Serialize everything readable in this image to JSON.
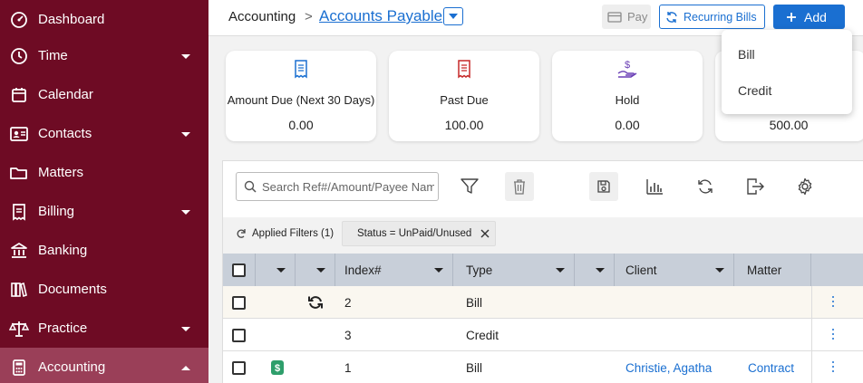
{
  "sidebar": {
    "items": [
      {
        "label": "Dashboard",
        "icon": "dashboard-icon"
      },
      {
        "label": "Time",
        "icon": "clock-icon"
      },
      {
        "label": "Calendar",
        "icon": "calendar-icon"
      },
      {
        "label": "Contacts",
        "icon": "contacts-icon"
      },
      {
        "label": "Matters",
        "icon": "folder-icon"
      },
      {
        "label": "Billing",
        "icon": "receipt-icon"
      },
      {
        "label": "Banking",
        "icon": "bank-icon"
      },
      {
        "label": "Documents",
        "icon": "books-icon"
      },
      {
        "label": "Practice",
        "icon": "scales-icon"
      },
      {
        "label": "Accounting",
        "icon": "calculator-icon"
      }
    ]
  },
  "header": {
    "breadcrumb_root": "Accounting",
    "breadcrumb_sep": ">",
    "breadcrumb_current": "Accounts Payable",
    "pay_label": "Pay",
    "recurring_label": "Recurring Bills",
    "add_label": "Add"
  },
  "cards": [
    {
      "label": "Amount Due (Next 30 Days)",
      "value": "0.00",
      "icon": "receipt-icon",
      "color": "#1a6fd1"
    },
    {
      "label": "Past Due",
      "value": "100.00",
      "icon": "receipt-icon",
      "color": "#c62828"
    },
    {
      "label": "Hold",
      "value": "0.00",
      "icon": "hand-money-icon",
      "color": "#6a3fb5"
    },
    {
      "label": "",
      "value": "500.00",
      "icon": "",
      "color": "#1a6fd1"
    }
  ],
  "add_menu": {
    "items": [
      "Bill",
      "Credit"
    ]
  },
  "grid": {
    "search_placeholder": "Search Ref#/Amount/Payee Name",
    "applied_filters": "Applied Filters (1)",
    "filter_chip": "Status = UnPaid/Unused",
    "columns": {
      "index": "Index#",
      "type": "Type",
      "client": "Client",
      "matter": "Matter"
    },
    "rows": [
      {
        "index": "2",
        "type": "Bill",
        "client": "",
        "matter": "",
        "icon": "recurring-icon"
      },
      {
        "index": "3",
        "type": "Credit",
        "client": "",
        "matter": "",
        "icon": ""
      },
      {
        "index": "1",
        "type": "Bill",
        "client": "Christie, Agatha",
        "matter": "Contract",
        "icon": "paid-badge-icon"
      }
    ]
  },
  "colors": {
    "sidebar": "#6e0b24",
    "sidebar_active": "#9a3f58",
    "accent": "#1a6fd1",
    "past_due": "#c62828",
    "paid_badge": "#2e9e6b"
  }
}
